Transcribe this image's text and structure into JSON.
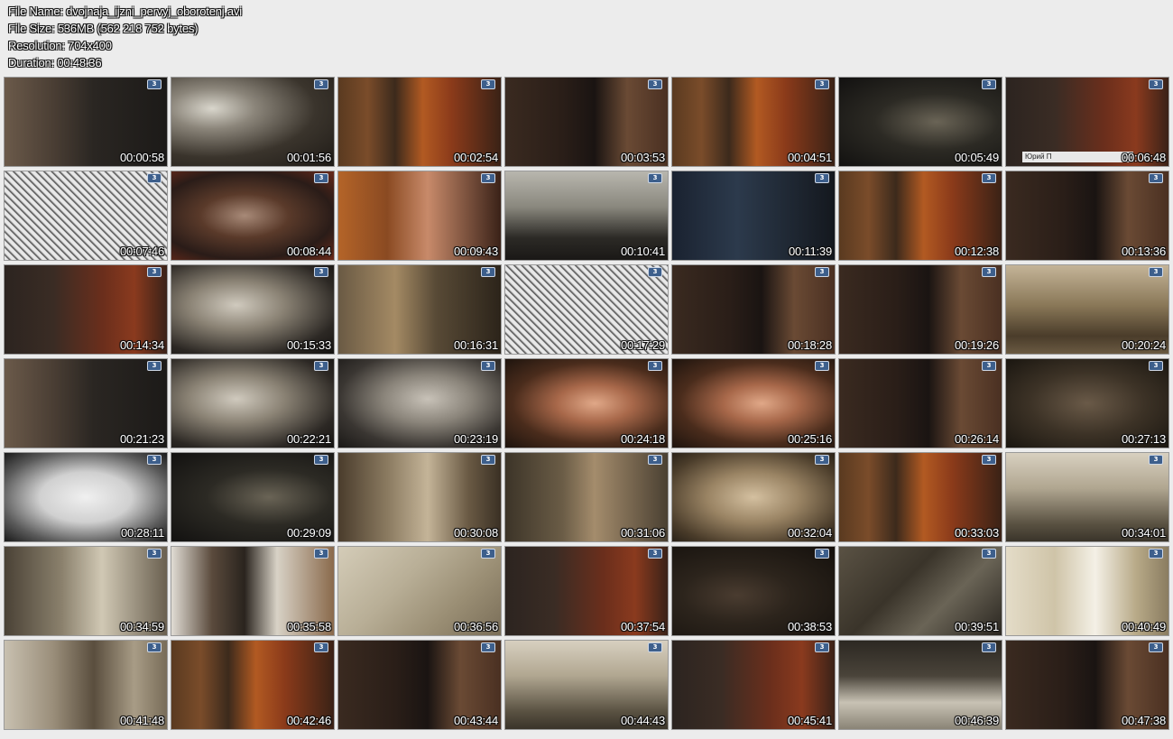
{
  "file_info": {
    "file_name": "File Name: dvojnaja_ijzni_pervyj_oborotenj.avi",
    "file_size": "File Size: 536MB (562 218 752 bytes)",
    "resolution": "Resolution: 704x400",
    "duration": "Duration: 00:48:36"
  },
  "channel_logo": "3",
  "thumbnails": [
    {
      "time": "00:00:58",
      "scene": "dim-street"
    },
    {
      "time": "00:01:56",
      "scene": "room-window"
    },
    {
      "time": "00:02:54",
      "scene": "woman-bookshelf"
    },
    {
      "time": "00:03:53",
      "scene": "bearded-man"
    },
    {
      "time": "00:04:51",
      "scene": "woman-bookshelf"
    },
    {
      "time": "00:05:49",
      "scene": "dark-room"
    },
    {
      "time": "00:06:48",
      "scene": "gray-man-desk",
      "caption": "Юрий П"
    },
    {
      "time": "00:07:46",
      "scene": "sketch"
    },
    {
      "time": "00:08:44",
      "scene": "gray-man-close"
    },
    {
      "time": "00:09:43",
      "scene": "woman-close"
    },
    {
      "time": "00:10:41",
      "scene": "old-photo-crowd"
    },
    {
      "time": "00:11:39",
      "scene": "dark-blue"
    },
    {
      "time": "00:12:38",
      "scene": "woman-bookshelf"
    },
    {
      "time": "00:13:36",
      "scene": "bearded-man"
    },
    {
      "time": "00:14:34",
      "scene": "gray-man-desk"
    },
    {
      "time": "00:15:33",
      "scene": "hands-paper"
    },
    {
      "time": "00:16:31",
      "scene": "sepia-portrait"
    },
    {
      "time": "00:17:29",
      "scene": "sketch"
    },
    {
      "time": "00:18:28",
      "scene": "bearded-man"
    },
    {
      "time": "00:19:26",
      "scene": "bearded-man"
    },
    {
      "time": "00:20:24",
      "scene": "sepia-crowd"
    },
    {
      "time": "00:21:23",
      "scene": "dim-street"
    },
    {
      "time": "00:22:21",
      "scene": "hands-paper"
    },
    {
      "time": "00:23:19",
      "scene": "bw-face"
    },
    {
      "time": "00:24:18",
      "scene": "warm-face"
    },
    {
      "time": "00:25:16",
      "scene": "warm-face"
    },
    {
      "time": "00:26:14",
      "scene": "bearded-man"
    },
    {
      "time": "00:27:13",
      "scene": "sepia-dark"
    },
    {
      "time": "00:28:11",
      "scene": "sketch-face"
    },
    {
      "time": "00:29:09",
      "scene": "dark-room"
    },
    {
      "time": "00:30:08",
      "scene": "sepia-room"
    },
    {
      "time": "00:31:06",
      "scene": "sepia-woman"
    },
    {
      "time": "00:32:04",
      "scene": "sepia-face"
    },
    {
      "time": "00:33:03",
      "scene": "woman-bookshelf"
    },
    {
      "time": "00:34:01",
      "scene": "sepia-crowd-light"
    },
    {
      "time": "00:34:59",
      "scene": "sepia-hat"
    },
    {
      "time": "00:35:58",
      "scene": "courtyard"
    },
    {
      "time": "00:36:56",
      "scene": "document"
    },
    {
      "time": "00:37:54",
      "scene": "gray-man-desk"
    },
    {
      "time": "00:38:53",
      "scene": "wheel"
    },
    {
      "time": "00:39:51",
      "scene": "revolver"
    },
    {
      "time": "00:40:49",
      "scene": "bright-room"
    },
    {
      "time": "00:41:48",
      "scene": "sepia-street"
    },
    {
      "time": "00:42:46",
      "scene": "woman-bookshelf"
    },
    {
      "time": "00:43:44",
      "scene": "bearded-man"
    },
    {
      "time": "00:44:43",
      "scene": "sepia-crowd-light"
    },
    {
      "time": "00:45:41",
      "scene": "gray-man-desk"
    },
    {
      "time": "00:46:39",
      "scene": "table-room"
    },
    {
      "time": "00:47:38",
      "scene": "bearded-man"
    }
  ]
}
